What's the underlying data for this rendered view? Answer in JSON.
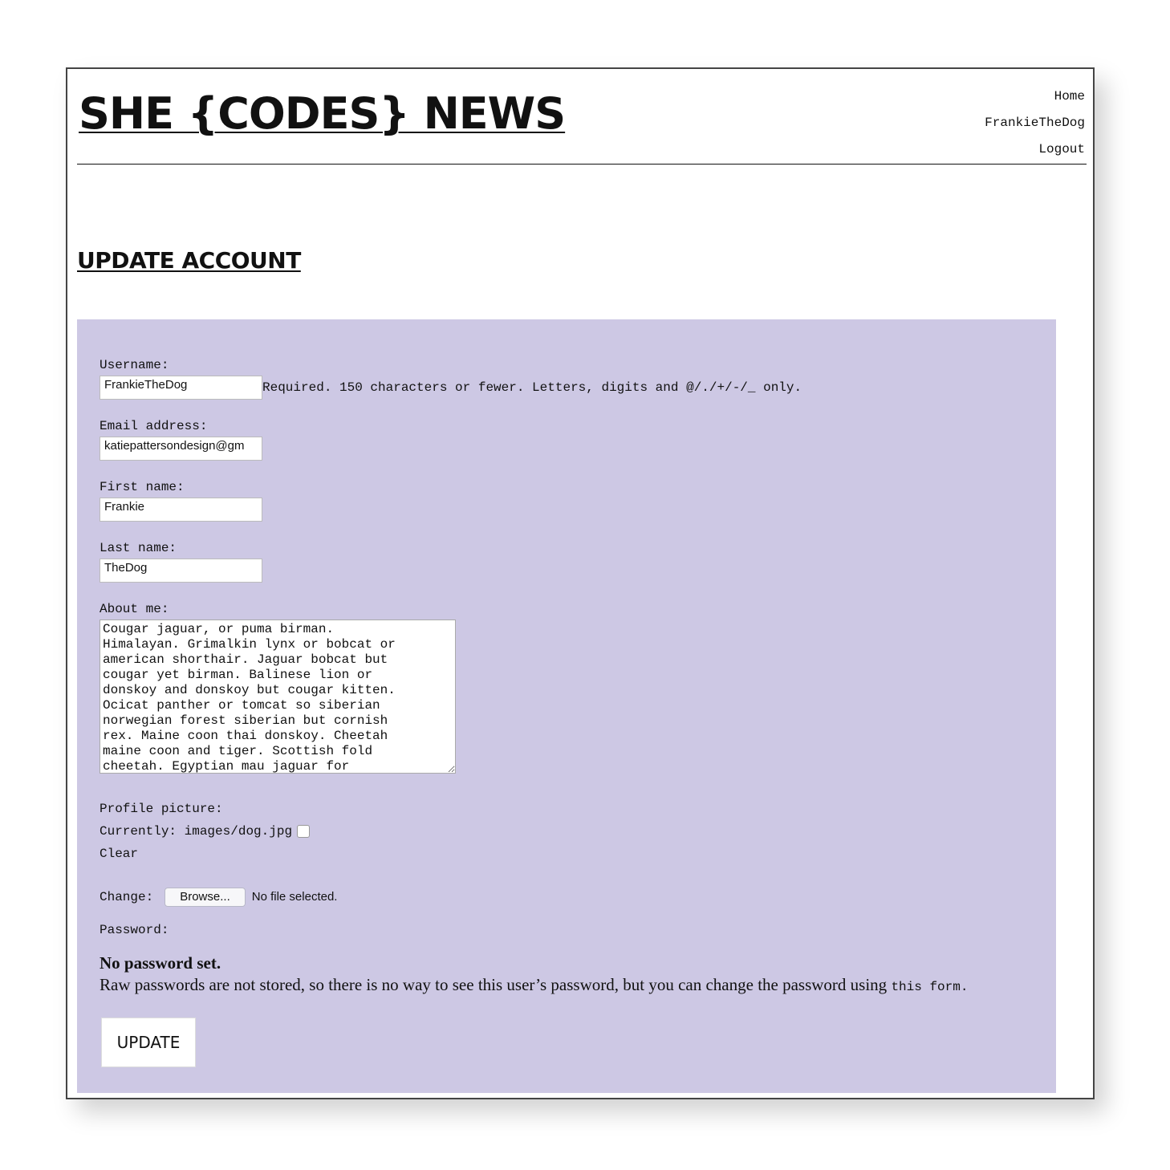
{
  "site": {
    "title": "SHE {CODES} NEWS"
  },
  "nav": {
    "items": [
      "Home",
      "FrankieTheDog",
      "Logout"
    ]
  },
  "page": {
    "heading": "UPDATE ACCOUNT"
  },
  "form": {
    "username": {
      "label": "Username:",
      "value": "FrankieTheDog",
      "help": "Required. 150 characters or fewer. Letters, digits and @/./+/-/_ only."
    },
    "email": {
      "label": "Email address:",
      "value": "katiepattersondesign@gm"
    },
    "first_name": {
      "label": "First name:",
      "value": "Frankie"
    },
    "last_name": {
      "label": "Last name:",
      "value": "TheDog"
    },
    "about": {
      "label": "About me:",
      "value": "Cougar jaguar, or puma birman.\nHimalayan. Grimalkin lynx or bobcat or\namerican shorthair. Jaguar bobcat but\ncougar yet birman. Balinese lion or\ndonskoy and donskoy but cougar kitten.\nOcicat panther or tomcat so siberian\nnorwegian forest siberian but cornish\nrex. Maine coon thai donskoy. Cheetah\nmaine coon and tiger. Scottish fold\ncheetah. Egyptian mau jaguar for"
    },
    "profile_picture": {
      "label": "Profile picture:",
      "currently_label": "Currently:",
      "current_file": "images/dog.jpg",
      "clear_label": "Clear",
      "change_label": "Change:",
      "browse_label": "Browse...",
      "no_file": "No file selected."
    },
    "password": {
      "label": "Password:",
      "title": "No password set.",
      "text": "Raw passwords are not stored, so there is no way to see this user’s password, but you can change the password using ",
      "link": "this form",
      "end": "."
    },
    "submit_label": "UPDATE"
  },
  "colors": {
    "panel": "#cdc8e4",
    "border": "#444444"
  }
}
